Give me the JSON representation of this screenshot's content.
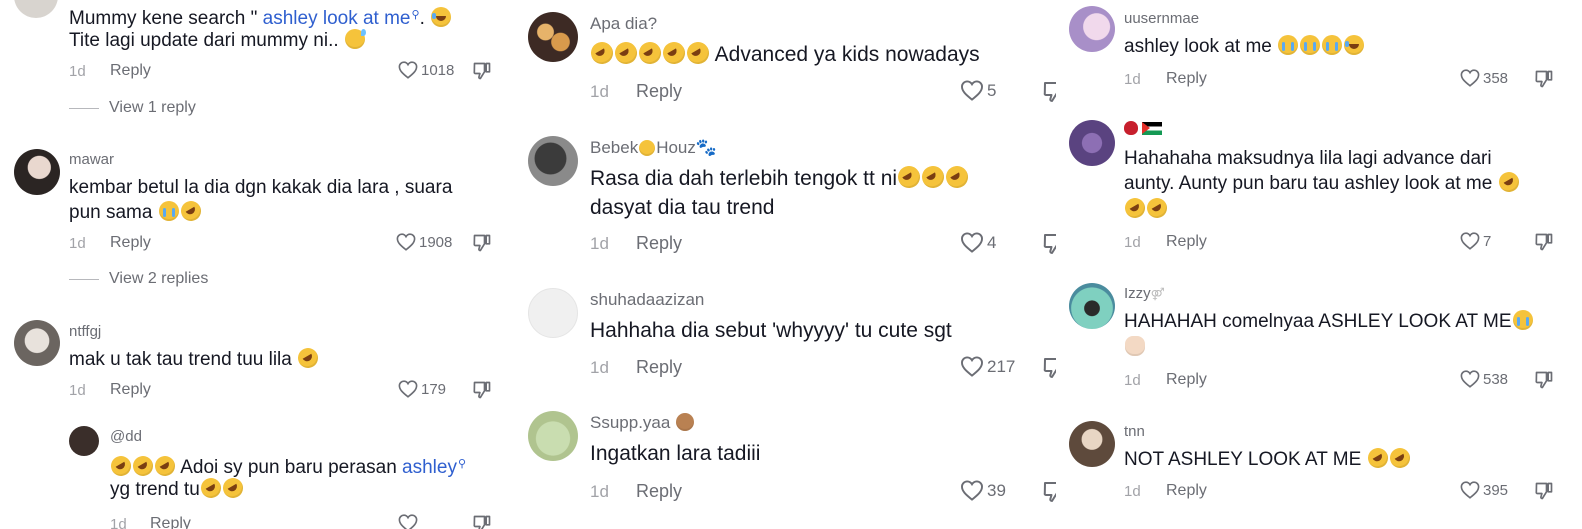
{
  "col1": {
    "c1": {
      "text_pre": "Mummy kene search \" ",
      "link": "ashley look at me",
      "text_post": ". ",
      "line2": "Tite lagi update dari mummy ni.. ",
      "date": "1d",
      "reply": "Reply",
      "likes": "1018",
      "view_replies": "View 1 reply"
    },
    "c2": {
      "username": "mawar",
      "line1": "kembar betul la dia dgn kakak dia lara , suara",
      "line2": "pun sama ",
      "date": "1d",
      "reply": "Reply",
      "likes": "1908",
      "view_replies": "View 2 replies"
    },
    "c3": {
      "username": "ntffgj",
      "line1": "mak u tak tau trend tuu lila ",
      "date": "1d",
      "reply": "Reply",
      "likes": "179"
    },
    "c4": {
      "username": "@dd",
      "line1_text": " Adoi sy pun baru perasan ",
      "line1_link": "ashley",
      "line2": "yg trend tu",
      "date": "1d",
      "reply": "Reply"
    }
  },
  "col2": {
    "c1": {
      "username": "Apa dia?",
      "line1": " Advanced ya kids nowadays",
      "date": "1d",
      "reply": "Reply",
      "likes": "5"
    },
    "c2": {
      "username_a": "Bebek",
      "username_b": "Houz",
      "line1": "Rasa dia dah terlebih tengok tt ni",
      "line2": "dasyat dia tau trend",
      "date": "1d",
      "reply": "Reply",
      "likes": "4"
    },
    "c3": {
      "username": "shuhadaazizan",
      "line1": "Hahhaha dia sebut 'whyyyy' tu cute sgt",
      "date": "1d",
      "reply": "Reply",
      "likes": "217"
    },
    "c4": {
      "username": "Ssupp.yaa ",
      "line1": "Ingatkan lara tadiii",
      "date": "1d",
      "reply": "Reply",
      "likes": "39"
    }
  },
  "col3": {
    "c1": {
      "username": "uusernmae",
      "line1": "ashley look at me ",
      "date": "1d",
      "reply": "Reply",
      "likes": "358"
    },
    "c2": {
      "line1": "Hahahaha maksudnya lila lagi advance dari",
      "line2": "aunty. Aunty pun baru tau ashley look at me ",
      "date": "1d",
      "reply": "Reply",
      "likes": "7"
    },
    "c3": {
      "username": "Izzy",
      "line1": "HAHAHAH comelnyaa ASHLEY LOOK AT ME",
      "date": "1d",
      "reply": "Reply",
      "likes": "538"
    },
    "c4": {
      "username": "tnn",
      "line1": "NOT ASHLEY LOOK AT ME ",
      "date": "1d",
      "reply": "Reply",
      "likes": "395"
    }
  },
  "colors": {
    "link": "#2f5fcf",
    "text": "#161823",
    "muted": "#6b6d74",
    "date": "#a2a3a8"
  },
  "icons": [
    "heart-outline-icon",
    "dislike-icon",
    "search-mini-icon"
  ]
}
